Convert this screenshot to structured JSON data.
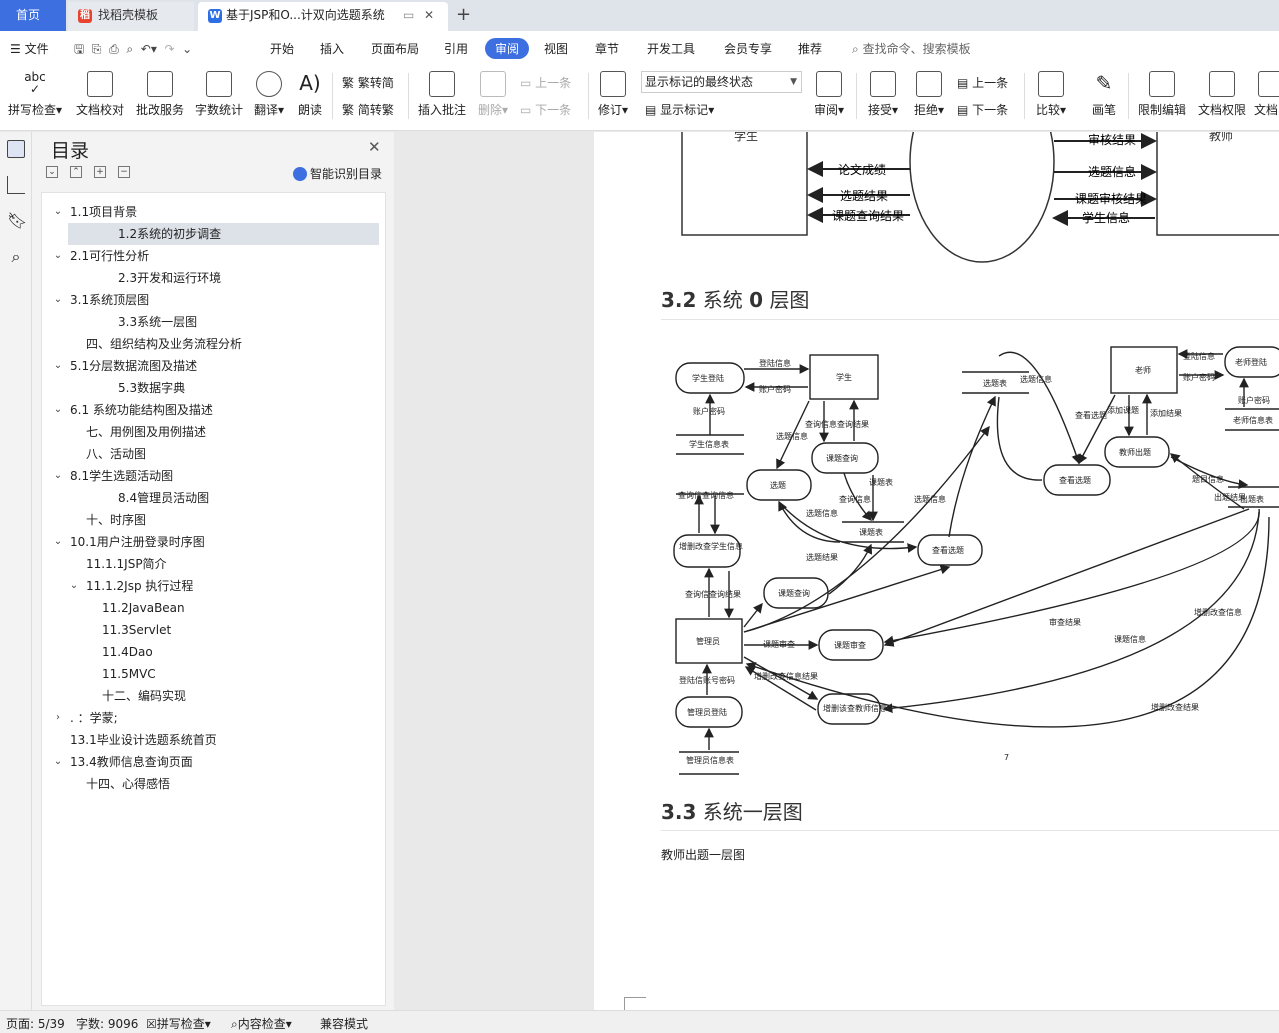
{
  "tabs": {
    "home": "首页",
    "daoke": "找稻壳模板",
    "doc": "基于JSP和O...计双向选题系统"
  },
  "menu": {
    "file": "文件",
    "items": [
      "开始",
      "插入",
      "页面布局",
      "引用",
      "审阅",
      "视图",
      "章节",
      "开发工具",
      "会员专享",
      "推荐"
    ],
    "search": "查找命令、搜索模板"
  },
  "ribbon": {
    "spell": "拼写检查",
    "proof": "文档校对",
    "batch": "批改服务",
    "wordcount": "字数统计",
    "translate": "翻译",
    "read": "朗读",
    "to_trad": "繁转简",
    "to_simp": "简转繁",
    "insert_comment": "插入批注",
    "delete": "删除",
    "prev_comment": "上一条",
    "next_comment": "下一条",
    "track": "修订",
    "markup_state": "显示标记的最终状态",
    "show_markup": "显示标记",
    "review": "审阅",
    "accept": "接受",
    "reject": "拒绝",
    "prev_change": "上一条",
    "next_change": "下一条",
    "compare": "比较",
    "pen": "画笔",
    "restrict": "限制编辑",
    "permission": "文档权限",
    "doc_more": "文档"
  },
  "nav": {
    "title": "目录",
    "smart": "智能识别目录",
    "items": [
      {
        "label": "1.1项目背景",
        "level": 1,
        "caret": "v"
      },
      {
        "label": "1.2系统的初步调查",
        "level": 3,
        "caret": "",
        "selected": true
      },
      {
        "label": "2.1可行性分析",
        "level": 1,
        "caret": "v"
      },
      {
        "label": "2.3开发和运行环境",
        "level": 3,
        "caret": ""
      },
      {
        "label": "3.1系统顶层图",
        "level": 1,
        "caret": "v"
      },
      {
        "label": "3.3系统一层图",
        "level": 3,
        "caret": ""
      },
      {
        "label": "四、组织结构及业务流程分析",
        "level": 2,
        "caret": ""
      },
      {
        "label": "5.1分层数据流图及描述",
        "level": 1,
        "caret": "v"
      },
      {
        "label": "5.3数据字典",
        "level": 3,
        "caret": ""
      },
      {
        "label": "6.1 系统功能结构图及描述",
        "level": 1,
        "caret": "v"
      },
      {
        "label": "七、用例图及用例描述",
        "level": 2,
        "caret": ""
      },
      {
        "label": "八、活动图",
        "level": 2,
        "caret": ""
      },
      {
        "label": "8.1学生选题活动图",
        "level": 1,
        "caret": "v"
      },
      {
        "label": "8.4管理员活动图",
        "level": 3,
        "caret": ""
      },
      {
        "label": "十、时序图",
        "level": 2,
        "caret": ""
      },
      {
        "label": "10.1用户注册登录时序图",
        "level": 1,
        "caret": "v"
      },
      {
        "label": "11.1.1JSP简介",
        "level": 2,
        "caret": ""
      },
      {
        "label": "11.1.2Jsp 执行过程",
        "level": 2,
        "caret": "v"
      },
      {
        "label": "11.2JavaBean",
        "level": 2.5,
        "caret": ""
      },
      {
        "label": "11.3Servlet",
        "level": 2.5,
        "caret": ""
      },
      {
        "label": "11.4Dao",
        "level": 2.5,
        "caret": ""
      },
      {
        "label": "11.5MVC",
        "level": 2.5,
        "caret": ""
      },
      {
        "label": "十二、编码实现",
        "level": 2.5,
        "caret": ""
      },
      {
        "label": ". ：学蒙;",
        "level": 1,
        "caret": ">"
      },
      {
        "label": "13.1毕业设计选题系统首页",
        "level": 1,
        "caret": ""
      },
      {
        "label": "13.4教师信息查询页面",
        "level": 1,
        "caret": "v"
      },
      {
        "label": "十四、心得感悟",
        "level": 2,
        "caret": ""
      }
    ]
  },
  "doc": {
    "top_fig": {
      "student": "学生",
      "teacher": "教师",
      "left_flows": [
        "论文成绩",
        "选题结果",
        "课题查询结果"
      ],
      "right_flows": [
        "审核结果",
        "选题信息",
        "课题审核结果",
        "学生信息"
      ]
    },
    "heading_32_num": "3.2",
    "heading_32_text": "系统",
    "heading_32_zero": "0",
    "heading_32_tail": "层图",
    "heading_33_num": "3.3",
    "heading_33_text": "系统一层图",
    "caption": "教师出题一层图",
    "fig": {
      "student_login": "学生登陆",
      "student": "学生",
      "login_info": "登陆信息",
      "account_pwd": "账户密码",
      "student_info_table": "学生信息表",
      "query_info": "查询信息查询结果",
      "select_info": "选题信息",
      "topic_query": "课题查询",
      "topic_table_label": "课题表",
      "select": "选题",
      "query_info2": "查询信息",
      "select_info2": "选题信息",
      "topic_table": "课题表",
      "select_result": "选题结果",
      "view_select": "查看选题",
      "query_info3": "查询信查询信息",
      "crud_student": "增删改查学生信息",
      "query_result": "查询信查询结果",
      "topic_query2": "课题查询",
      "admin": "管理员",
      "topic_review_lbl": "课题审查",
      "topic_review": "课题审查",
      "login_pwd": "登陆信账号密码",
      "crud_info": "增删改查信息结果",
      "crud_teacher": "增删该查教师信息",
      "admin_login": "管理员登陆",
      "admin_info_table": "管理员信息表",
      "select_table": "选题表",
      "select_info3": "选题信息",
      "teacher": "老师",
      "view_select_lbl": "查看选题",
      "add_topic": "添加课题",
      "add_result": "添加结果",
      "view_select2": "查看选题",
      "teacher_topic": "教师出题",
      "login_info2": "登陆信息",
      "account_pwd2": "账户密码",
      "teacher_login": "老师登陆",
      "account_pwd3": "账户密码",
      "teacher_info_table": "老师信息表",
      "topic_info": "题目信息",
      "topic_result": "出题结果",
      "topic_table2": "出题表",
      "select_info4": "选题信息",
      "review_result": "审查结果",
      "topic_info2": "课题信息",
      "crud_info2": "增删改查信息",
      "crud_result": "增删改查结果",
      "page_mark": "7"
    }
  },
  "status": {
    "page": "页面: 5/39",
    "words": "字数: 9096",
    "spell": "拼写检查",
    "content": "内容检查",
    "compat": "兼容模式"
  }
}
